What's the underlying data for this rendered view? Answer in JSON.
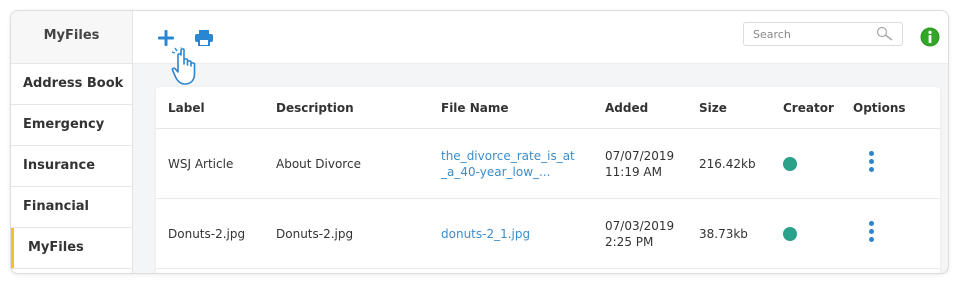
{
  "colors": {
    "accent": "#2a86d0",
    "active_marker": "#f2c12e",
    "creator_dot": "#2aa189",
    "info_green": "#2e9b23",
    "link": "#3d8dc9"
  },
  "sidebar": {
    "title": "MyFiles",
    "items": [
      {
        "label": "Address Book",
        "active": false
      },
      {
        "label": "Emergency",
        "active": false
      },
      {
        "label": "Insurance",
        "active": false
      },
      {
        "label": "Financial",
        "active": false
      },
      {
        "label": "MyFiles",
        "active": true
      }
    ]
  },
  "toolbar": {
    "add_icon": "plus-icon",
    "print_icon": "printer-icon",
    "cursor_icon": "hand-pointer-icon",
    "search_placeholder": "Search",
    "search_icon": "magnifier-icon",
    "info_icon": "info-icon"
  },
  "table": {
    "headers": {
      "label": "Label",
      "description": "Description",
      "file_name": "File Name",
      "added": "Added",
      "size": "Size",
      "creator": "Creator",
      "options": "Options"
    },
    "rows": [
      {
        "label": "WSJ Article",
        "description": "About Divorce",
        "file_name_line1": "the_divorce_rate_is_at",
        "file_name_line2": "_a_40-year_low_...",
        "added_date": "07/07/2019",
        "added_time": "11:19 AM",
        "size": "216.42kb"
      },
      {
        "label": "Donuts-2.jpg",
        "description": "Donuts-2.jpg",
        "file_name_line1": "donuts-2_1.jpg",
        "file_name_line2": "",
        "added_date": "07/03/2019",
        "added_time": "2:25 PM",
        "size": "38.73kb"
      }
    ]
  }
}
